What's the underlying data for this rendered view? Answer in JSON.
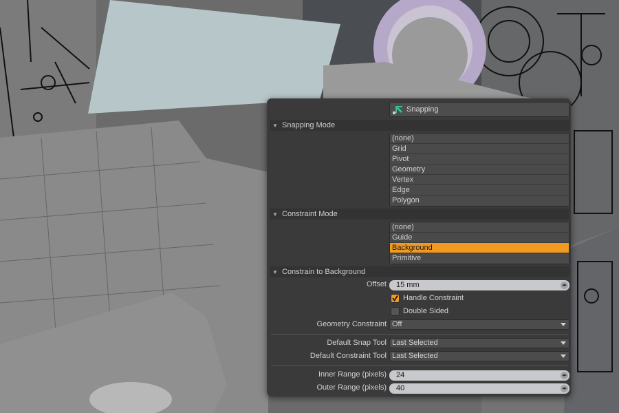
{
  "panel": {
    "snapping_button": "Snapping",
    "sections": {
      "snapping_mode": "Snapping Mode",
      "constraint_mode": "Constraint Mode",
      "constrain_background": "Constrain to Background"
    },
    "snapping_modes": [
      "(none)",
      "Grid",
      "Pivot",
      "Geometry",
      "Vertex",
      "Edge",
      "Polygon"
    ],
    "constraint_modes": [
      "(none)",
      "Guide",
      "Background",
      "Primitive"
    ],
    "constraint_mode_selected": "Background",
    "offset": {
      "label": "Offset",
      "value": "15 mm"
    },
    "handle_constraint": {
      "label": "Handle Constraint",
      "checked": true
    },
    "double_sided": {
      "label": "Double Sided",
      "checked": false
    },
    "geometry_constraint": {
      "label": "Geometry Constraint",
      "value": "Off"
    },
    "default_snap_tool": {
      "label": "Default Snap Tool",
      "value": "Last Selected"
    },
    "default_constraint_tool": {
      "label": "Default Constraint Tool",
      "value": "Last Selected"
    },
    "inner_range": {
      "label": "Inner Range (pixels)",
      "value": "24"
    },
    "outer_range": {
      "label": "Outer Range (pixels)",
      "value": "40"
    }
  },
  "colors": {
    "accent": "#f29a1f",
    "panel_bg": "#3a3a3a",
    "viewport_bg": "#6e6e6e"
  }
}
